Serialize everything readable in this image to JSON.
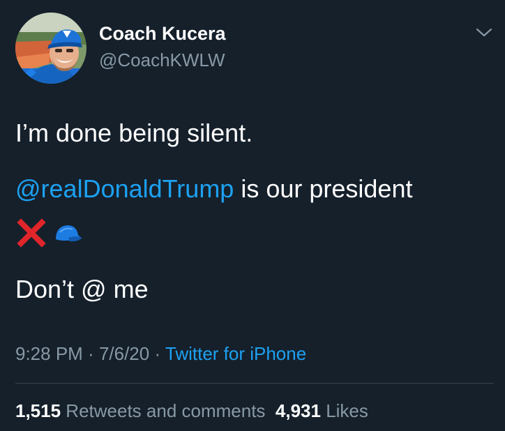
{
  "author": {
    "display_name": "Coach Kucera",
    "handle": "@CoachKWLW",
    "avatar_icon": "profile-photo-icon"
  },
  "menu": {
    "icon": "chevron-down-icon"
  },
  "tweet": {
    "line1": "I’m done being silent.",
    "mention": "@realDonaldTrump",
    "line2_rest": " is our president",
    "emojis": [
      "cross-mark-icon",
      "blue-cap-icon"
    ],
    "line3": "Don’t @ me"
  },
  "meta": {
    "time": "9:28 PM",
    "sep1": " · ",
    "date": "7/6/20",
    "sep2": " · ",
    "source": "Twitter for iPhone"
  },
  "stats": {
    "retweets_count": "1,515",
    "retweets_label": " Retweets and comments",
    "likes_count": "4,931",
    "likes_label": " Likes"
  },
  "colors": {
    "background": "#15202b",
    "link": "#1da1f2",
    "muted": "#8899a6",
    "divider": "#38444d"
  }
}
